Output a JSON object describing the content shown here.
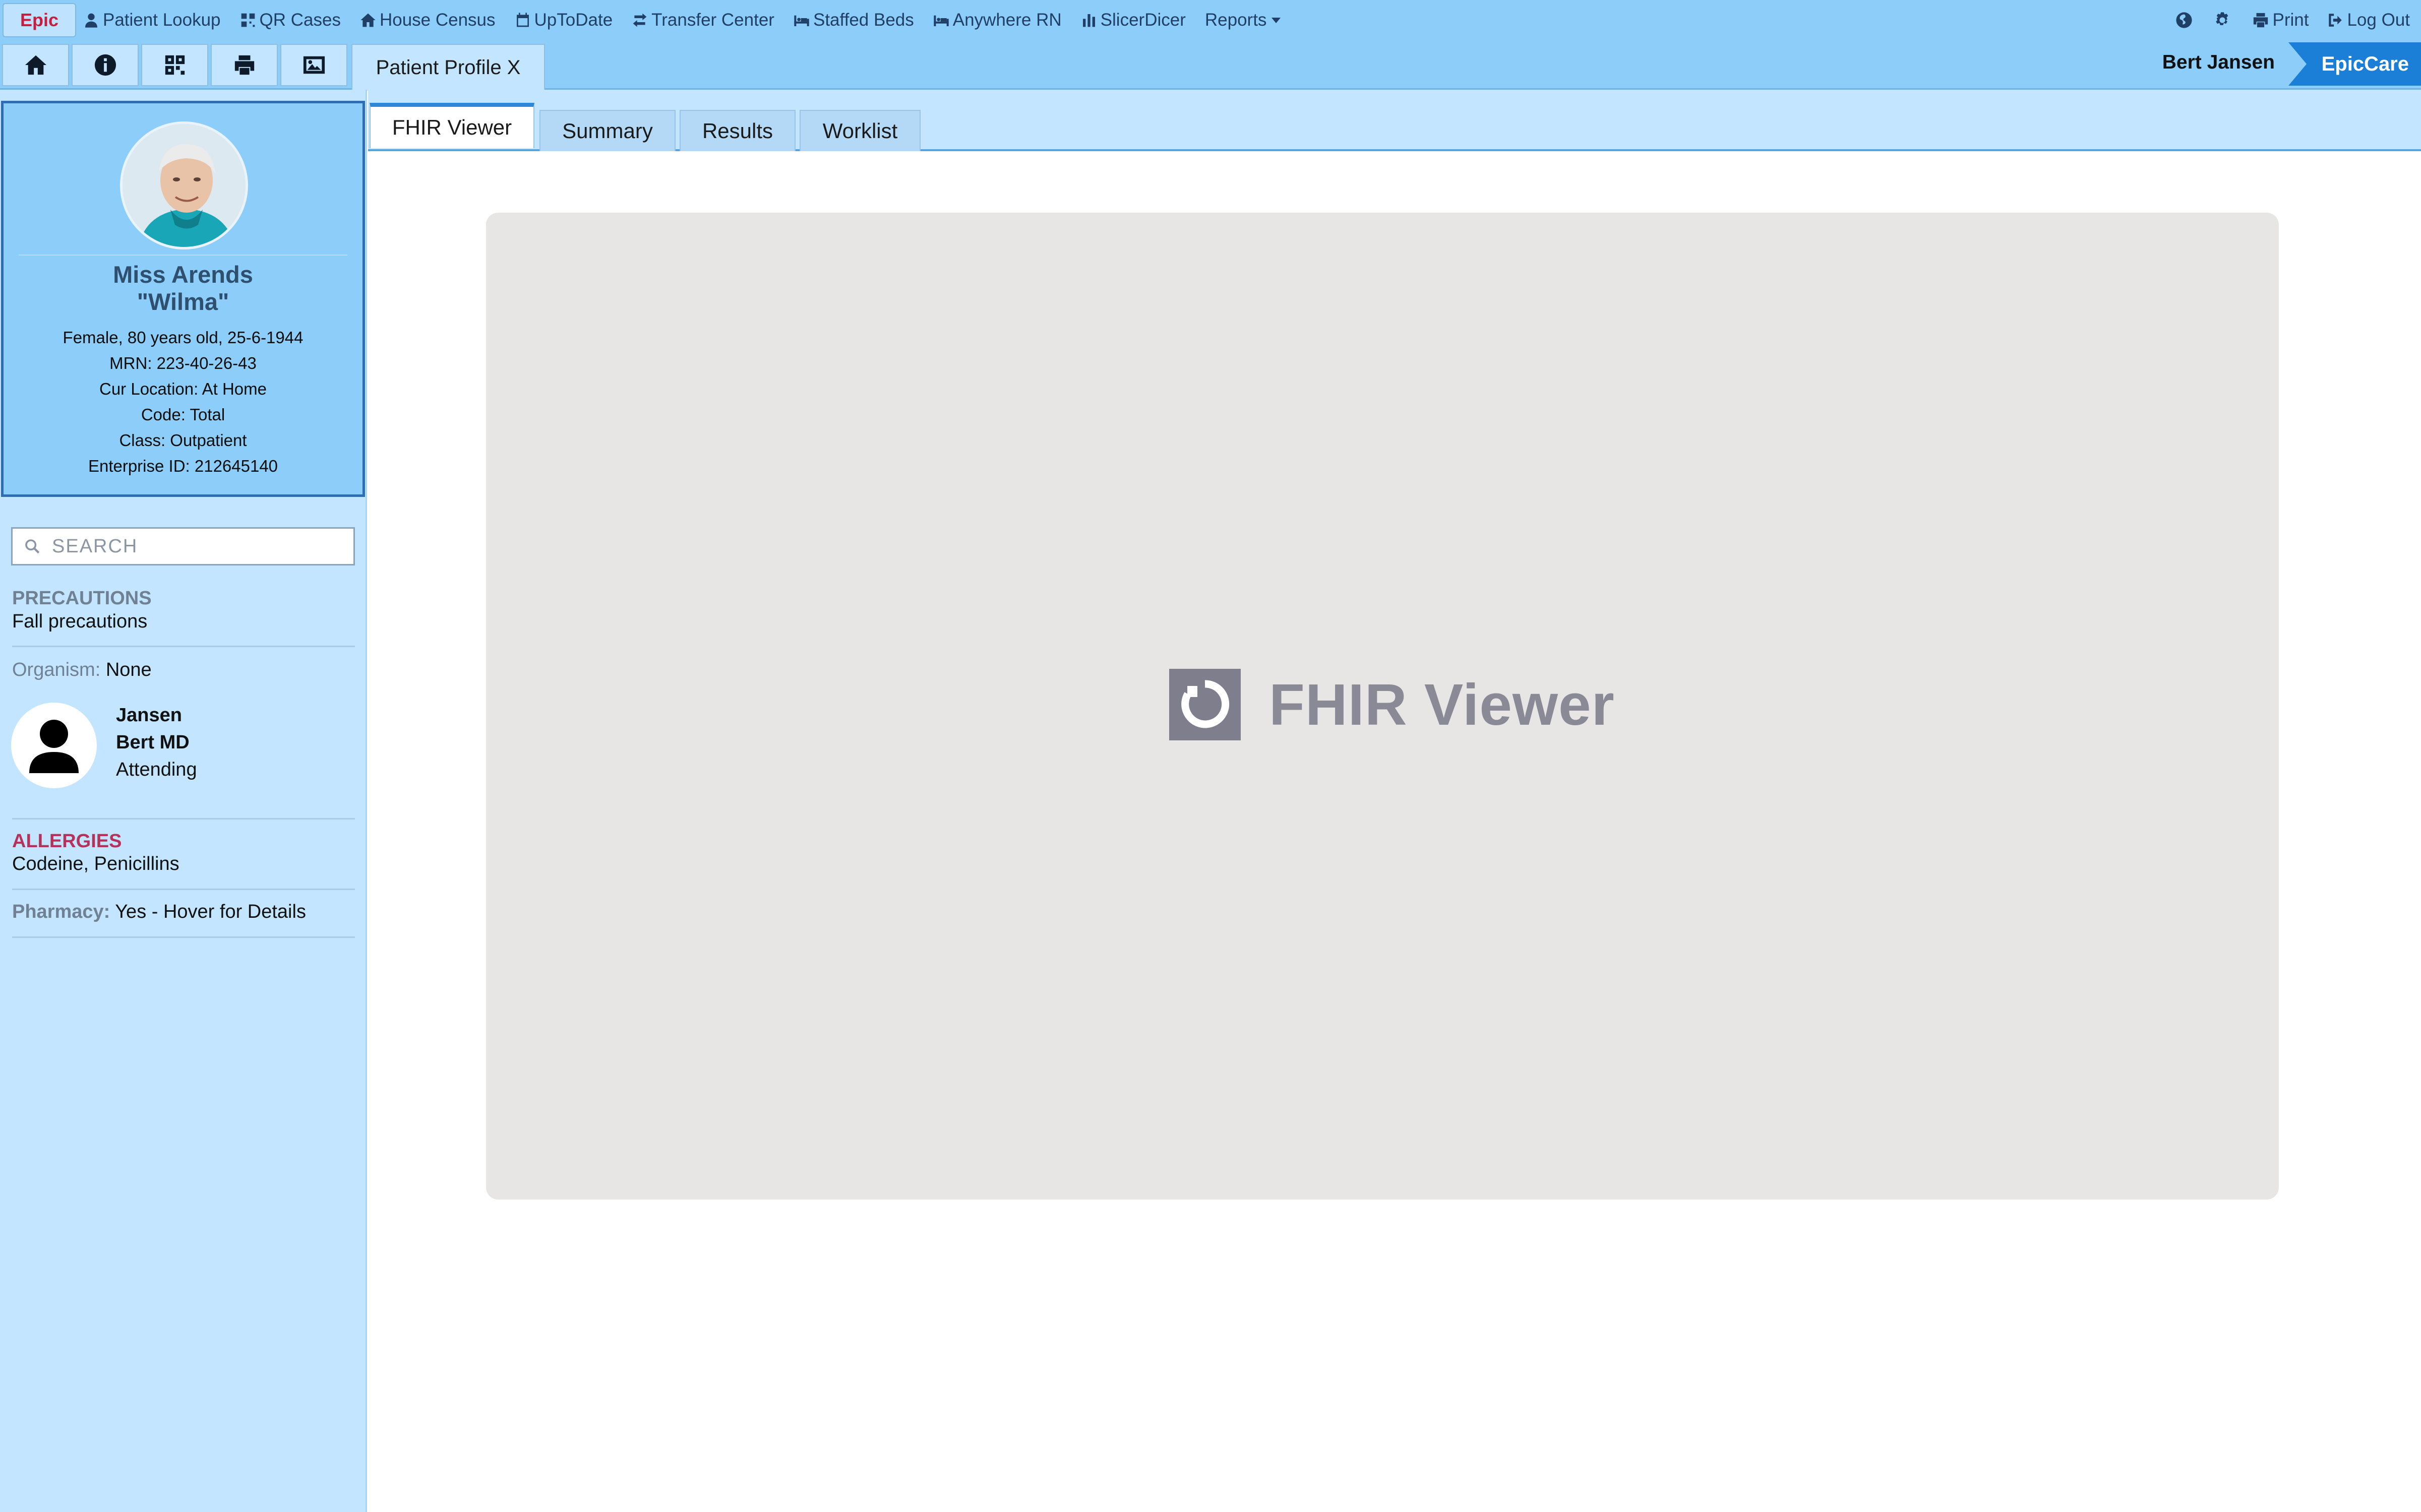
{
  "app": {
    "logo_text": "Epic",
    "brand": "EpicCare",
    "user_name": "Bert Jansen"
  },
  "menu": [
    {
      "label": "Patient Lookup",
      "icon": "user-icon"
    },
    {
      "label": "QR Cases",
      "icon": "qr-icon"
    },
    {
      "label": "House Census",
      "icon": "house-icon"
    },
    {
      "label": "UpToDate",
      "icon": "calendar-icon"
    },
    {
      "label": "Transfer Center",
      "icon": "transfer-icon"
    },
    {
      "label": "Staffed Beds",
      "icon": "bed-icon"
    },
    {
      "label": "Anywhere RN",
      "icon": "bed-icon"
    },
    {
      "label": "SlicerDicer",
      "icon": "bar-chart-icon"
    },
    {
      "label": "Reports",
      "icon": "caret-down-icon"
    }
  ],
  "right_menu": {
    "print_label": "Print",
    "logout_label": "Log Out"
  },
  "toolbar": {
    "buttons": [
      "home-icon",
      "info-icon",
      "grid-icon",
      "printer-icon",
      "image-icon"
    ],
    "workspace_tab": "Patient Profile X"
  },
  "patient": {
    "name": "Miss Arends",
    "nickname": "\"Wilma\"",
    "demographics": "Female, 80 years old, 25-6-1944",
    "mrn": "MRN: 223-40-26-43",
    "location": "Cur Location: At Home",
    "code": "Code: Total",
    "class": "Class: Outpatient",
    "enterprise_id": "Enterprise ID: 212645140"
  },
  "search": {
    "placeholder": "SEARCH"
  },
  "sidebar": {
    "precautions_title": "PRECAUTIONS",
    "precautions_value": "Fall precautions",
    "organism_label": "Organism:",
    "organism_value": "None",
    "provider": {
      "last_name": "Jansen",
      "first_name": "Bert MD",
      "role": "Attending"
    },
    "allergies_title": "ALLERGIES",
    "allergies_value": "Codeine, Penicillins",
    "pharmacy_label": "Pharmacy:",
    "pharmacy_value": "Yes - Hover for Details"
  },
  "content_tabs": [
    {
      "label": "FHIR Viewer",
      "active": true
    },
    {
      "label": "Summary",
      "active": false
    },
    {
      "label": "Results",
      "active": false
    },
    {
      "label": "Worklist",
      "active": false
    }
  ],
  "viewer": {
    "logo_text": "FHIR Viewer"
  },
  "colors": {
    "bar_blue": "#8ccdf9",
    "sidebar_blue": "#c3e5ff",
    "brand_blue": "#1b7fd8",
    "allergies_red": "#b5325a",
    "section_grey": "#6f8193"
  }
}
